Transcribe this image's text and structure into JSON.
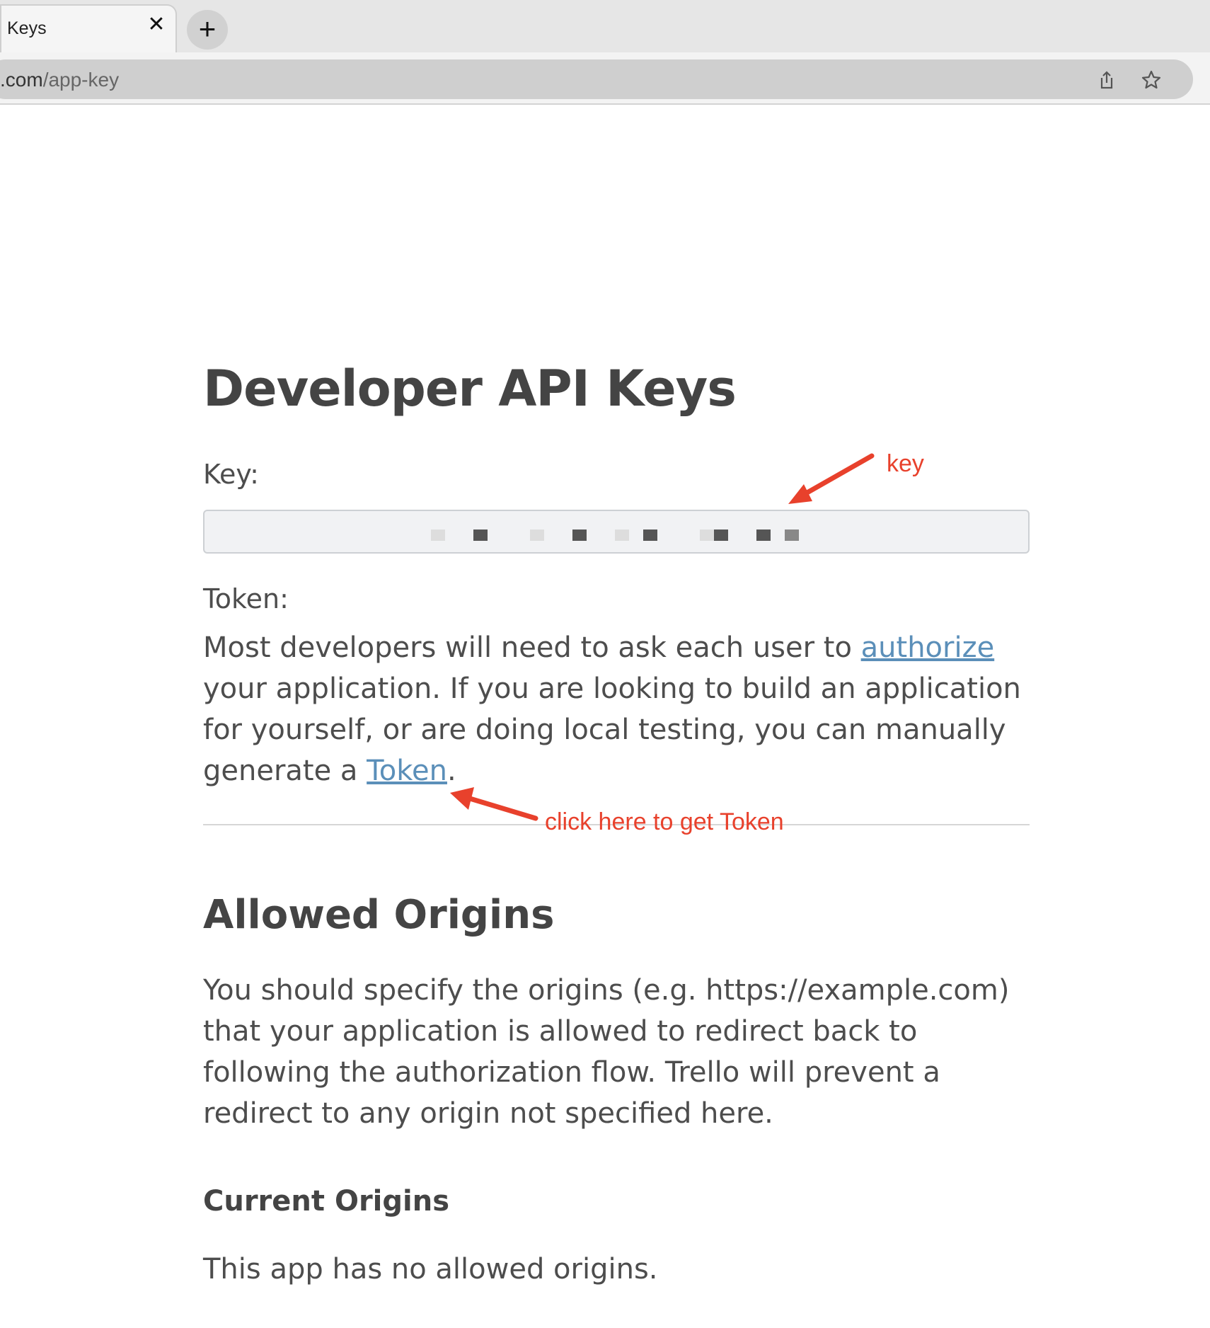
{
  "browser": {
    "tab_title": "Keys",
    "tab_close": "✕",
    "new_tab": "+",
    "url_domain": ".com",
    "url_path": "/app-key"
  },
  "page": {
    "title": "Developer API Keys",
    "key_label": "Key:",
    "token_label": "Token:",
    "token_para_1": "Most developers will need to ask each user to ",
    "authorize_link": "authorize",
    "token_para_2": " your application. If you are looking to build an application for yourself, or are doing local testing, you can manually generate a ",
    "token_link": "Token",
    "token_para_3": ".",
    "origins_title": "Allowed Origins",
    "origins_para": "You should specify the origins (e.g. https://example.com) that your application is allowed to redirect back to following the authorization flow. Trello will prevent a redirect to any origin not specified here.",
    "current_origins_title": "Current Origins",
    "current_origins_text": "This app has no allowed origins."
  },
  "annotations": {
    "key_note": "key",
    "token_note": "click here to get Token",
    "color": "#e8412c"
  },
  "icons": {
    "share": "share-icon",
    "bookmark": "star-icon"
  }
}
